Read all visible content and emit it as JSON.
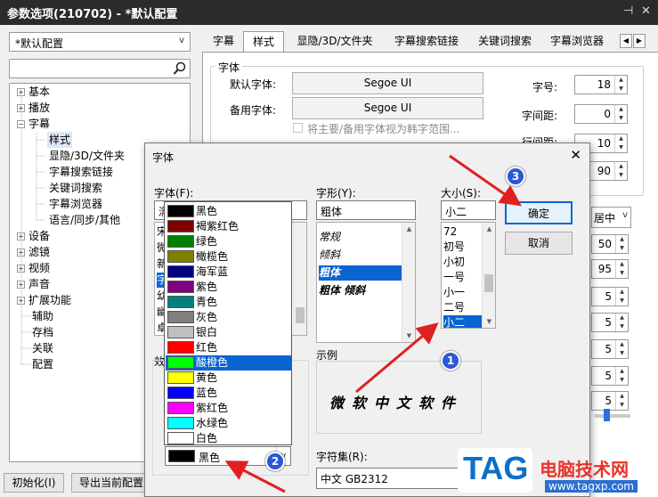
{
  "window": {
    "title": "参数选项(210702) - *默认配置",
    "pin": "⊣",
    "close": "✕"
  },
  "profile_combo": {
    "value": "*默认配置"
  },
  "tree": {
    "items": [
      {
        "label": "基本",
        "expand": "+"
      },
      {
        "label": "播放",
        "expand": "+"
      },
      {
        "label": "字幕",
        "expand": "−"
      },
      {
        "label": "样式"
      },
      {
        "label": "显隐/3D/文件夹"
      },
      {
        "label": "字幕搜索链接"
      },
      {
        "label": "关键词搜索"
      },
      {
        "label": "字幕浏览器"
      },
      {
        "label": "语言/同步/其他"
      },
      {
        "label": "设备",
        "expand": "+"
      },
      {
        "label": "滤镜",
        "expand": "+"
      },
      {
        "label": "视频",
        "expand": "+"
      },
      {
        "label": "声音",
        "expand": "+"
      },
      {
        "label": "扩展功能",
        "expand": "+"
      },
      {
        "label": "辅助"
      },
      {
        "label": "存档"
      },
      {
        "label": "关联"
      },
      {
        "label": "配置"
      }
    ]
  },
  "bottom_buttons": {
    "init": "初始化(I)",
    "export": "导出当前配置"
  },
  "tabs": [
    "字幕",
    "样式",
    "显隐/3D/文件夹",
    "字幕搜索链接",
    "关键词搜索",
    "字幕浏览器"
  ],
  "font_group": {
    "title": "字体",
    "default_label": "默认字体:",
    "default_value": "Segoe UI",
    "backup_label": "备用字体:",
    "backup_value": "Segoe UI",
    "checkbox_label": "将主要/备用字体视为韩字范围...",
    "size_label": "字号:",
    "size_value": "18",
    "spacing_label": "字间距:",
    "spacing_value": "0",
    "line_label": "行间距:",
    "line_value": "10",
    "extra_value": "90"
  },
  "right_column": {
    "align_value": "居中",
    "spins": [
      "50",
      "95",
      "5",
      "5",
      "5",
      "5",
      "5"
    ]
  },
  "dialog": {
    "title": "字体",
    "close": "✕",
    "font_label": "字体(F):",
    "font_value": "濡",
    "font_list": [
      "宋",
      "微",
      "新",
      "字",
      "幼",
      "幽",
      "卓"
    ],
    "style_label": "字形(Y):",
    "style_value": "粗体",
    "style_list": [
      "常规",
      "倾斜",
      "粗体",
      "粗体 倾斜"
    ],
    "style_selected": 2,
    "size_label": "大小(S):",
    "size_value": "小二",
    "size_list": [
      "72",
      "初号",
      "小初",
      "一号",
      "小一",
      "二号",
      "小二"
    ],
    "size_selected": 6,
    "ok": "确定",
    "cancel": "取消",
    "sample_label": "示例",
    "sample_text": "微软中文软件",
    "charset_label": "字符集(R):",
    "charset_value": "中文 GB2312",
    "color_value": "黑色",
    "effects_stub": "效"
  },
  "colors": [
    {
      "name": "黑色",
      "hex": "#000000"
    },
    {
      "name": "褐紫红色",
      "hex": "#800000"
    },
    {
      "name": "绿色",
      "hex": "#008000"
    },
    {
      "name": "橄榄色",
      "hex": "#808000"
    },
    {
      "name": "海军蓝",
      "hex": "#000080"
    },
    {
      "name": "紫色",
      "hex": "#800080"
    },
    {
      "name": "青色",
      "hex": "#008080"
    },
    {
      "name": "灰色",
      "hex": "#808080"
    },
    {
      "name": "银白",
      "hex": "#c0c0c0"
    },
    {
      "name": "红色",
      "hex": "#ff0000"
    },
    {
      "name": "酸橙色",
      "hex": "#00ff00"
    },
    {
      "name": "黄色",
      "hex": "#ffff00"
    },
    {
      "name": "蓝色",
      "hex": "#0000ff"
    },
    {
      "name": "紫红色",
      "hex": "#ff00ff"
    },
    {
      "name": "水绿色",
      "hex": "#00ffff"
    },
    {
      "name": "白色",
      "hex": "#ffffff"
    }
  ],
  "color_selected": 10,
  "badges": [
    "1",
    "2",
    "3"
  ],
  "watermark": {
    "tag": "TAG",
    "site_name": "电脑技术网",
    "url": "www.tagxp.com"
  },
  "accent": "#0a64d2",
  "arrow_color": "#e02020"
}
